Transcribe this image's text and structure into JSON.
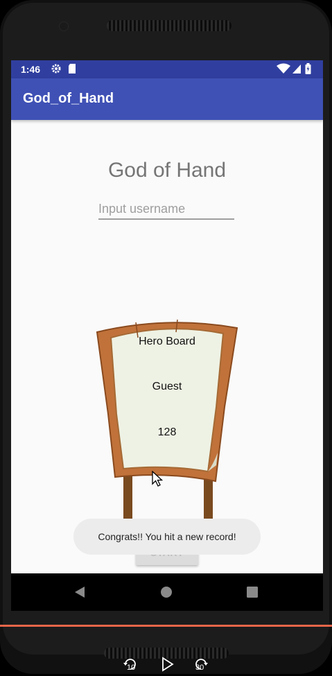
{
  "status_bar": {
    "time": "1:46",
    "icons": [
      "settings-gear-icon",
      "sd-card-icon",
      "wifi-icon",
      "signal-icon",
      "battery-icon"
    ]
  },
  "app_bar": {
    "title": "God_of_Hand"
  },
  "main": {
    "heading": "God of Hand",
    "username_placeholder": "Input username",
    "board": {
      "title": "Hero Board",
      "player_name": "Guest",
      "score": "128"
    },
    "start_label": "START"
  },
  "toast": {
    "message": "Congrats!! You hit a new record!"
  },
  "nav_bar": {
    "icons": [
      "back-icon",
      "home-icon",
      "recents-icon"
    ]
  },
  "player_controls": {
    "rewind_label": "10",
    "forward_label": "30"
  },
  "colors": {
    "status_bar": "#303f9f",
    "app_bar": "#3f51b5",
    "screen_bg": "#fafafa",
    "accent_line": "#e8654a"
  }
}
